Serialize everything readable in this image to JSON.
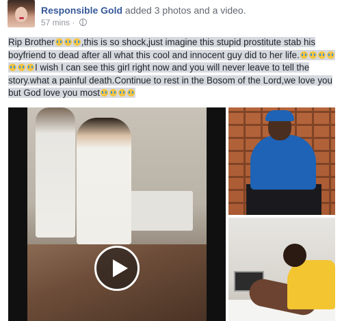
{
  "post": {
    "poster_name": "Responsible Gold",
    "action": " added 3 photos and a video.",
    "timestamp": "57 mins",
    "separator": " · ",
    "privacy_icon": "globe-icon",
    "text": {
      "seg1": "Rip Brother",
      "seg2": ",this is so shock,just imagine this stupid prostitute stab his boyfriend to dead after all what this cool and innocent guy did to her life.",
      "seg3": "I wish I can see this girl right now and you will never leave to tell the story.what a painful death.Continue to rest in the Bosom of the Lord,we love you but God love you most"
    },
    "emoji_icon": "crying-face-icon"
  },
  "media": {
    "video": {
      "play_icon": "play-icon"
    },
    "photos_count": 3,
    "video_count": 1
  }
}
